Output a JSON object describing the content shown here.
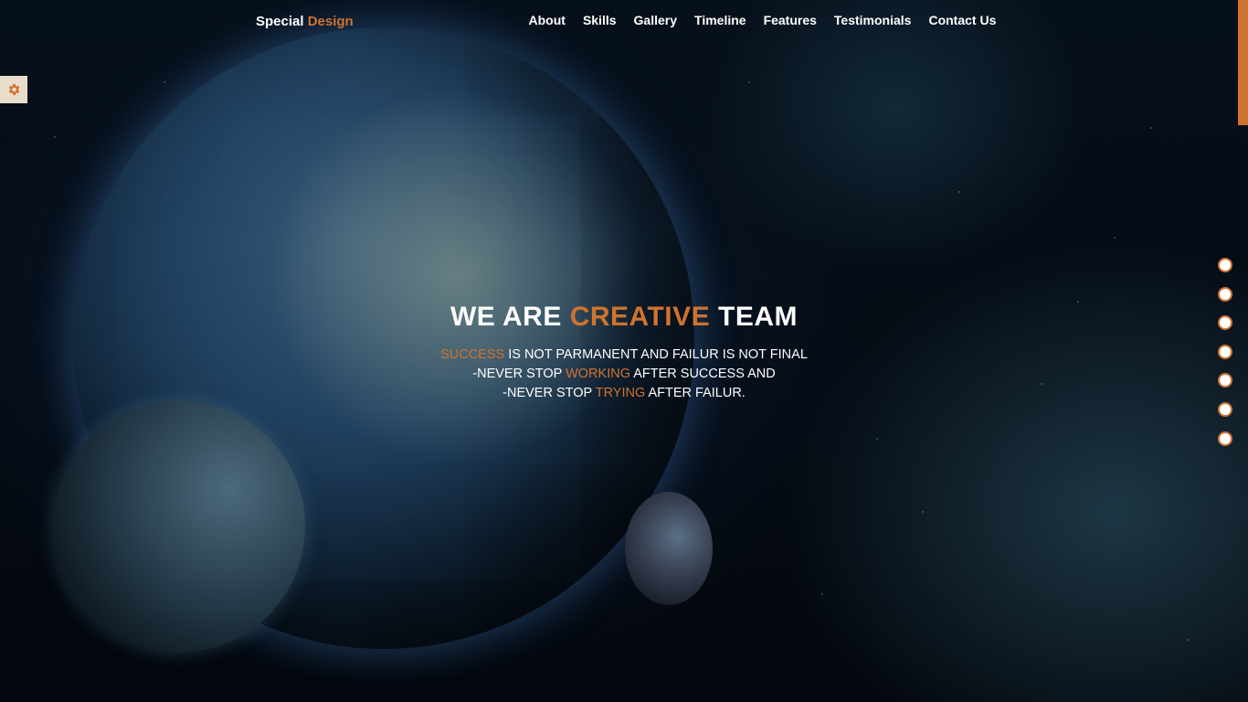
{
  "colors": {
    "accent": "#cf7330",
    "text": "#ffffff",
    "background": "#05101a"
  },
  "header": {
    "logo_main": "Special",
    "logo_accent": "Design"
  },
  "nav": {
    "items": [
      {
        "label": "About"
      },
      {
        "label": "Skills"
      },
      {
        "label": "Gallery"
      },
      {
        "label": "Timeline"
      },
      {
        "label": "Features"
      },
      {
        "label": "Testimonials"
      },
      {
        "label": "Contact Us"
      }
    ]
  },
  "settings": {
    "icon": "gear-icon"
  },
  "hero": {
    "title_part1": "WE ARE",
    "title_accent": "CREATIVE",
    "title_part2": "TEAM",
    "line1_accent": "SUCCESS",
    "line1_rest": "IS NOT PARMANENT AND FAILUR IS NOT FINAL",
    "line2_start": "-NEVER STOP",
    "line2_accent": "WORKING",
    "line2_rest": "AFTER SUCCESS AND",
    "line3_start": "-NEVER STOP",
    "line3_accent": "TRYING",
    "line3_rest": "AFTER FAILUR."
  },
  "bullets": {
    "count": 7
  }
}
